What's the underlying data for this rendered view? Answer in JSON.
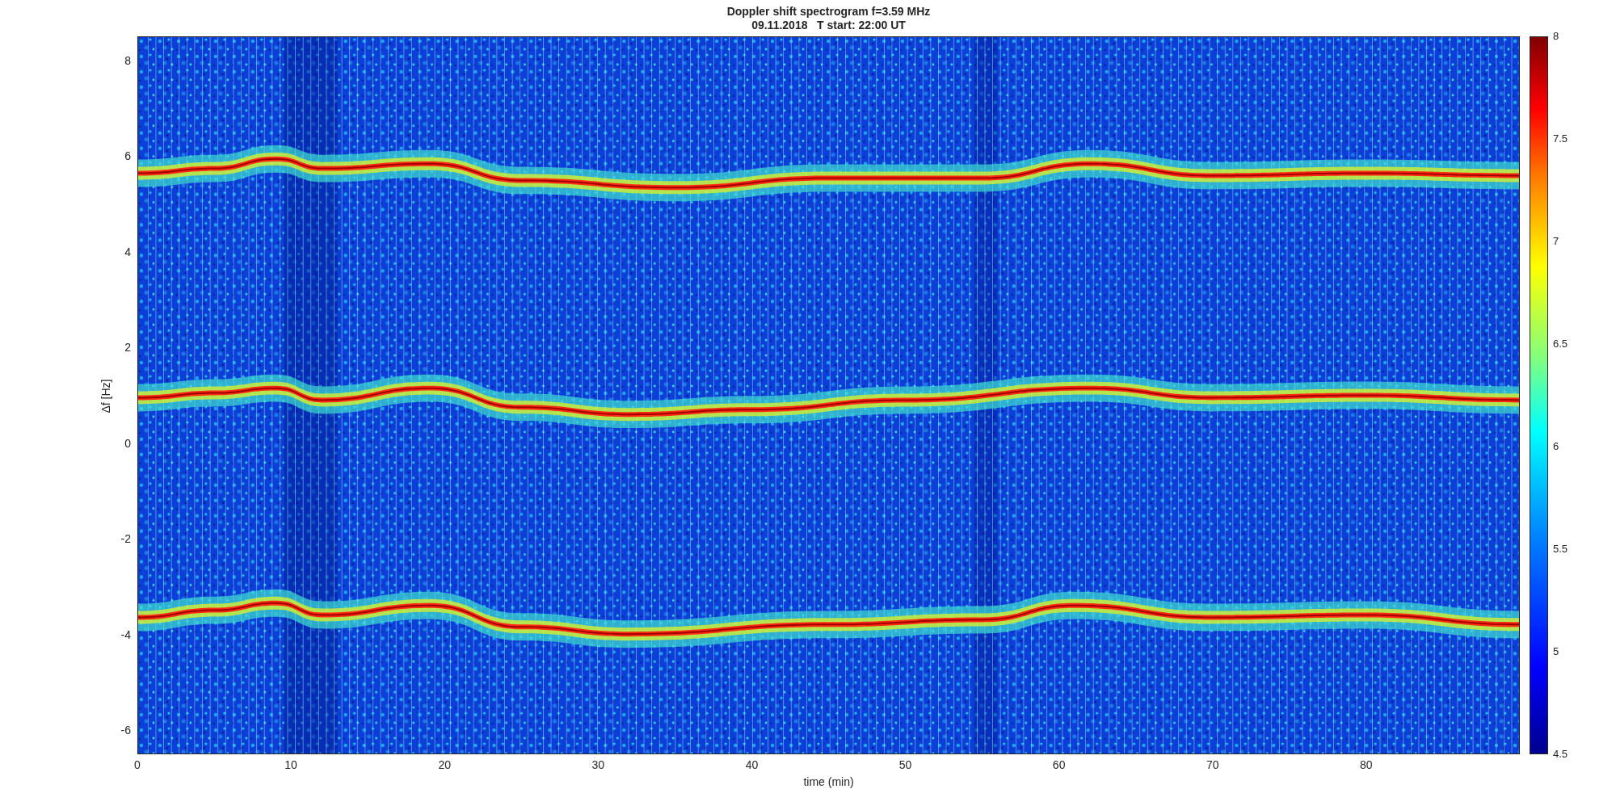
{
  "figure": {
    "title_lines": [
      "Doppler shift spectrogram f=3.59 MHz",
      "09.11.2018   T start: 22:00 UT"
    ]
  },
  "axes": {
    "xlabel": "time (min)",
    "ylabel": "Δf [Hz]",
    "x_ticks": [
      "0",
      "10",
      "20",
      "30",
      "40",
      "50",
      "60",
      "70",
      "80"
    ],
    "y_ticks": [
      "8",
      "6",
      "4",
      "2",
      "0",
      "-2",
      "-4",
      "-6"
    ]
  },
  "colorbar": {
    "ticks": [
      "8",
      "7.5",
      "7",
      "6.5",
      "6",
      "5.5",
      "5",
      "4.5"
    ]
  }
}
